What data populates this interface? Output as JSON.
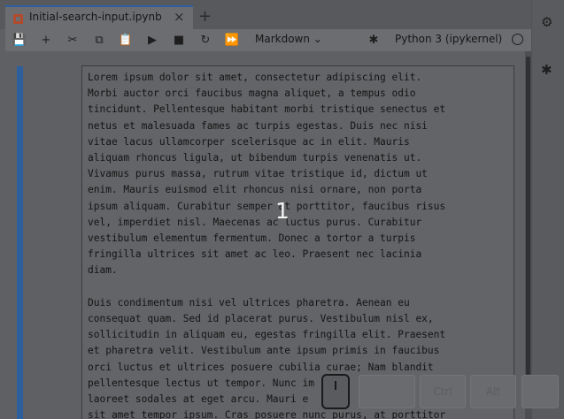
{
  "tab": {
    "title": "Initial-search-input.ipynb",
    "close": "×",
    "new_tab": "+"
  },
  "toolbar": {
    "save": "💾",
    "add": "+",
    "cut": "✂",
    "copy": "⧉",
    "paste": "📋",
    "run": "▶",
    "stop": "■",
    "restart": "↻",
    "run_all": "⏩",
    "cell_type": "Markdown ⌄",
    "kernel_name": "Python 3 (ipykernel)"
  },
  "overlay": {
    "number": "1"
  },
  "keys": {
    "ctrl": "Ctrl",
    "alt": "Alt"
  },
  "cell": {
    "paragraphs": [
      [
        "Lorem ipsum dolor sit amet, consectetur adipiscing elit.",
        "Morbi auctor orci faucibus magna aliquet, a tempus odio",
        "tincidunt. Pellentesque habitant morbi tristique senectus et",
        "netus et malesuada fames ac turpis egestas. Duis nec nisi",
        "vitae lacus ullamcorper scelerisque ac in elit. Mauris",
        "aliquam rhoncus ligula, ut bibendum turpis venenatis ut.",
        "Vivamus purus massa, rutrum vitae tristique id, dictum ut",
        "enim. Mauris euismod elit rhoncus nisi ornare, non porta",
        "ipsum aliquam. Curabitur semper at porttitor, faucibus risus",
        "vel, imperdiet nisl. Maecenas ac luctus purus. Curabitur",
        "vestibulum elementum fermentum. Donec a tortor a turpis",
        "fringilla ultrices sit amet ac leo. Praesent nec lacinia",
        "diam."
      ],
      [
        "Duis condimentum nisi vel ultrices pharetra. Aenean eu",
        "consequat quam. Sed id placerat purus. Vestibulum nisl ex,",
        "sollicitudin in aliquam eu, egestas fringilla elit. Praesent",
        "et pharetra velit. Vestibulum ante ipsum primis in faucibus",
        "orci luctus et ultrices posuere cubilia curae; Nam blandit",
        "pellentesque lectus ut tempor. Nunc im",
        "laoreet sodales at eget arcu. Mauri e",
        "sit amet tempor ipsum. Cras posuere nunc purus, at porttitor"
      ]
    ]
  }
}
